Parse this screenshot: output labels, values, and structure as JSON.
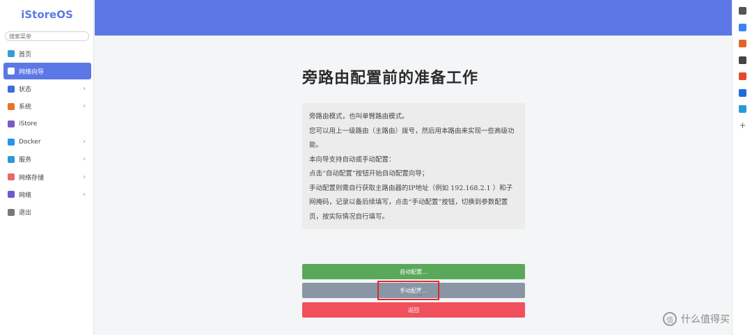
{
  "sidebar": {
    "brand": "iStoreOS",
    "search_placeholder": "搜索菜单",
    "items": [
      {
        "label": "首页",
        "icon": "home-icon",
        "color": "#3a9ad9",
        "has_chevron": false,
        "active": false
      },
      {
        "label": "网络向导",
        "icon": "globe-icon",
        "color": "#ffffff",
        "has_chevron": false,
        "active": true
      },
      {
        "label": "状态",
        "icon": "dashboard-icon",
        "color": "#3b6fd8",
        "has_chevron": true,
        "active": false
      },
      {
        "label": "系统",
        "icon": "gear-icon",
        "color": "#e8732b",
        "has_chevron": true,
        "active": false
      },
      {
        "label": "iStore",
        "icon": "store-icon",
        "color": "#7a5cc7",
        "has_chevron": false,
        "active": false
      },
      {
        "label": "Docker",
        "icon": "docker-icon",
        "color": "#2496ed",
        "has_chevron": true,
        "active": false
      },
      {
        "label": "服务",
        "icon": "services-icon",
        "color": "#2a9ad6",
        "has_chevron": true,
        "active": false
      },
      {
        "label": "网络存储",
        "icon": "storage-icon",
        "color": "#e56a6a",
        "has_chevron": true,
        "active": false
      },
      {
        "label": "网络",
        "icon": "network-icon",
        "color": "#6a5acd",
        "has_chevron": true,
        "active": false
      },
      {
        "label": "退出",
        "icon": "logout-icon",
        "color": "#777777",
        "has_chevron": false,
        "active": false
      }
    ]
  },
  "main": {
    "title": "旁路由配置前的准备工作",
    "description": [
      "旁路由模式，也叫单臂路由模式。",
      "您可以用上一级路由（主路由）拨号，然后用本路由来实现一些高级功能。",
      "本向导支持自动或手动配置：",
      "点击“自动配置”按钮开始自动配置向导；",
      "手动配置则需自行获取主路由器的IP地址（例如 192.168.2.1 ）和子网掩码，记录以备后续填写，点击“手动配置”按钮，切换到参数配置页，按实际情况自行填写。"
    ],
    "buttons": {
      "auto": "自动配置...",
      "manual": "手动配置...",
      "back": "返回"
    }
  },
  "right_toolbar": {
    "icons": [
      {
        "name": "search-tool-icon",
        "color": "#555555"
      },
      {
        "name": "tag-icon",
        "color": "#3b82f6"
      },
      {
        "name": "toolbox-icon",
        "color": "#e0652a"
      },
      {
        "name": "user-tool-icon",
        "color": "#444444"
      },
      {
        "name": "office-icon",
        "color": "#e34a2b"
      },
      {
        "name": "outlook-icon",
        "color": "#1e6fd9"
      },
      {
        "name": "cart-icon",
        "color": "#2a9ad6"
      },
      {
        "name": "plus-icon",
        "color": "#666666"
      }
    ]
  },
  "watermark": {
    "text": "什么值得买",
    "icon_glyph": "值"
  },
  "colors": {
    "accent": "#5b78e6",
    "auto_button": "#5aa85a",
    "manual_button": "#8a95a5",
    "back_button": "#f0505c",
    "highlight": "#d92b2b"
  }
}
